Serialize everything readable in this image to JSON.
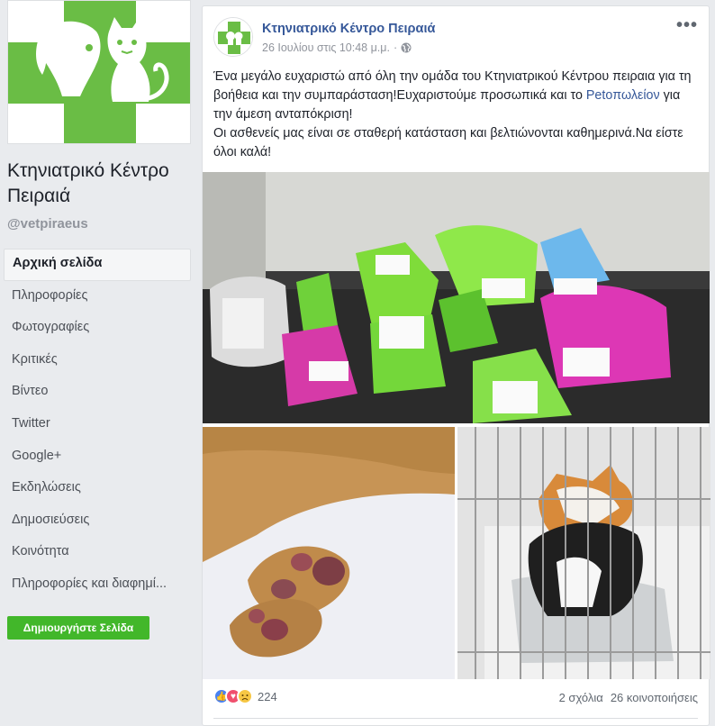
{
  "sidebar": {
    "page_name": "Κτηνιατρικό Κέντρο Πειραιά",
    "handle": "@vetpiraeus",
    "nav": [
      "Αρχική σελίδα",
      "Πληροφορίες",
      "Φωτογραφίες",
      "Κριτικές",
      "Βίντεο",
      "Twitter",
      "Google+",
      "Εκδηλώσεις",
      "Δημοσιεύσεις",
      "Κοινότητα",
      "Πληροφορίες και διαφημί..."
    ],
    "create_page": "Δημιουργήστε Σελίδα"
  },
  "post": {
    "author": "Κτηνιατρικό Κέντρο Πειραιά",
    "timestamp": "26 Ιουλίου στις 10:48 μ.μ.",
    "separator": "·",
    "more": "•••",
    "text_line1_a": "Ένα μεγάλο ευχαριστώ από όλη την ομάδα του Κτηνιατρικού Κέντρου πειραια για τη βοήθεια και την συμπαράσταση!Ευχαριστούμε προσωπικά και το ",
    "text_link": "Petoπωλείον",
    "text_line1_b": " για την άμεση ανταπόκριση!",
    "text_line2": "Οι ασθενείς μας είναι σε σταθερή κατάσταση και βελτιώνονται καθημερινά.Να είστε όλοι καλά!",
    "reactions_count": "224",
    "comments": "2 σχόλια",
    "shares": "26 κοινοποιήσεις"
  },
  "colors": {
    "brand_green": "#6abd45",
    "link_blue": "#365899",
    "create_green": "#42b72a"
  }
}
